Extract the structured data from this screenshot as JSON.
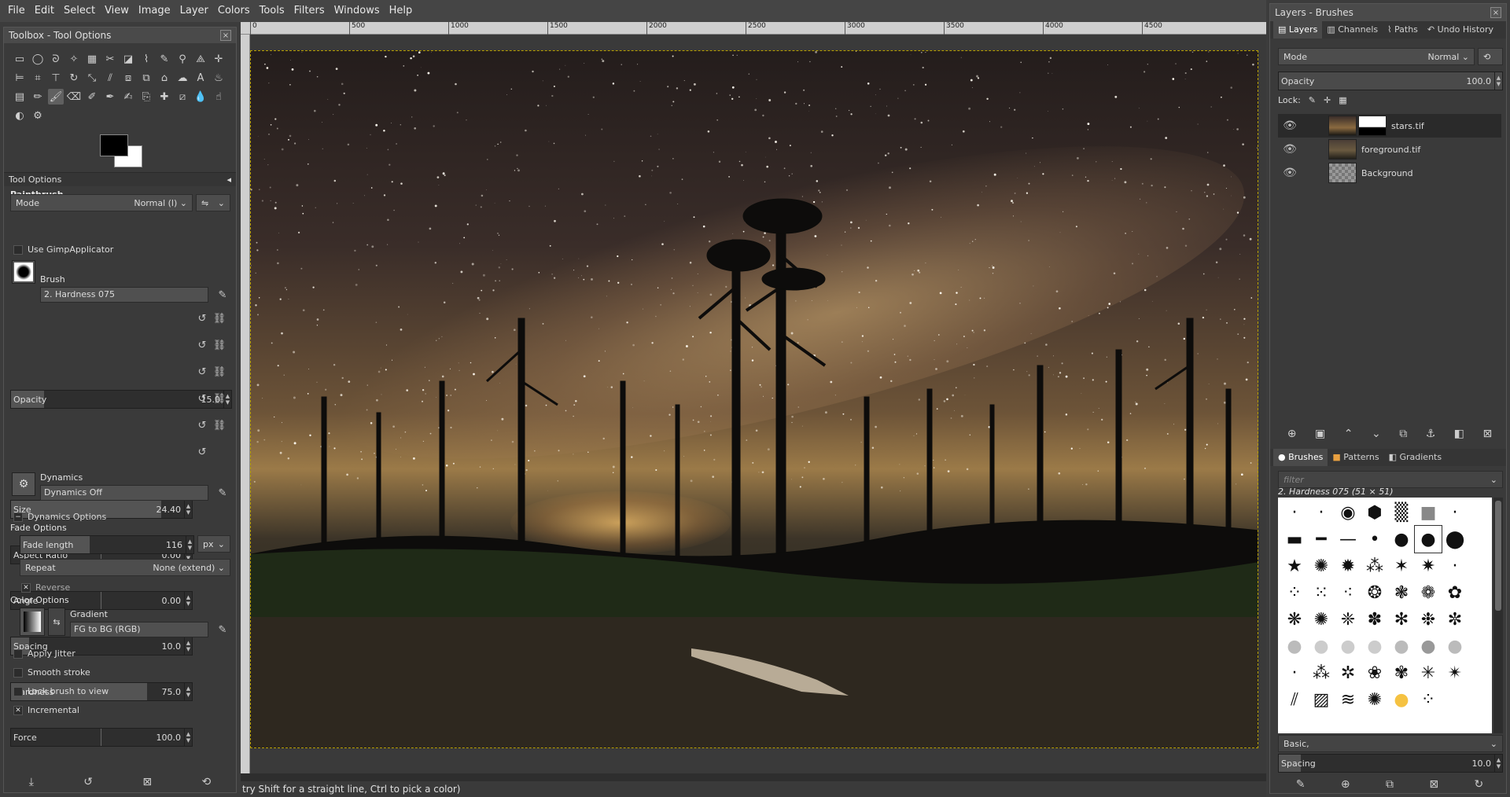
{
  "menu": [
    "File",
    "Edit",
    "Select",
    "View",
    "Image",
    "Layer",
    "Colors",
    "Tools",
    "Filters",
    "Windows",
    "Help"
  ],
  "toolbox": {
    "title": "Toolbox - Tool Options",
    "tool_options_tab": "Tool Options",
    "tool_name": "Paintbrush",
    "mode_label": "Mode",
    "mode_value": "Normal (l)",
    "opacity_label": "Opacity",
    "opacity_value": "15.0",
    "use_applicator": "Use GimpApplicator",
    "brush_label": "Brush",
    "brush_name": "2. Hardness 075",
    "sliders": [
      {
        "label": "Size",
        "value": "24.40",
        "fill": 0.83
      },
      {
        "label": "Aspect Ratio",
        "value": "0.00",
        "fill": 0.5
      },
      {
        "label": "Angle",
        "value": "0.00",
        "fill": 0.5
      },
      {
        "label": "Spacing",
        "value": "10.0",
        "fill": 0.1
      },
      {
        "label": "Hardness",
        "value": "75.0",
        "fill": 0.75
      },
      {
        "label": "Force",
        "value": "100.0",
        "fill": 0.5
      }
    ],
    "dynamics_label": "Dynamics",
    "dynamics_value": "Dynamics Off",
    "dynamics_options": "Dynamics Options",
    "fade_options": "Fade Options",
    "fade_length_label": "Fade length",
    "fade_length_value": "116",
    "fade_unit": "px",
    "repeat_label": "Repeat",
    "repeat_value": "None (extend)",
    "reverse": "Reverse",
    "color_options": "Color Options",
    "gradient_label": "Gradient",
    "gradient_value": "FG to BG (RGB)",
    "apply_jitter": "Apply Jitter",
    "smooth_stroke": "Smooth stroke",
    "lock_brush": "Lock brush to view",
    "incremental": "Incremental"
  },
  "ruler": [
    "0",
    "500",
    "1000",
    "1500",
    "2000",
    "2500",
    "3000",
    "3500",
    "4000",
    "4500"
  ],
  "status": "try Shift for a straight line, Ctrl to pick a color)",
  "dock": {
    "title": "Layers - Brushes",
    "tabs": [
      "Layers",
      "Channels",
      "Paths",
      "Undo History"
    ],
    "mode_label": "Mode",
    "mode_value": "Normal",
    "opacity_label": "Opacity",
    "opacity_value": "100.0",
    "lock_label": "Lock:",
    "layers": [
      "stars.tif",
      "foreground.tif",
      "Background"
    ],
    "brush_tabs": [
      "Brushes",
      "Patterns",
      "Gradients"
    ],
    "filter_placeholder": "filter",
    "brush_selected": "2. Hardness 075 (51 × 51)",
    "brush_tag": "Basic,",
    "spacing_label": "Spacing",
    "spacing_value": "10.0"
  }
}
